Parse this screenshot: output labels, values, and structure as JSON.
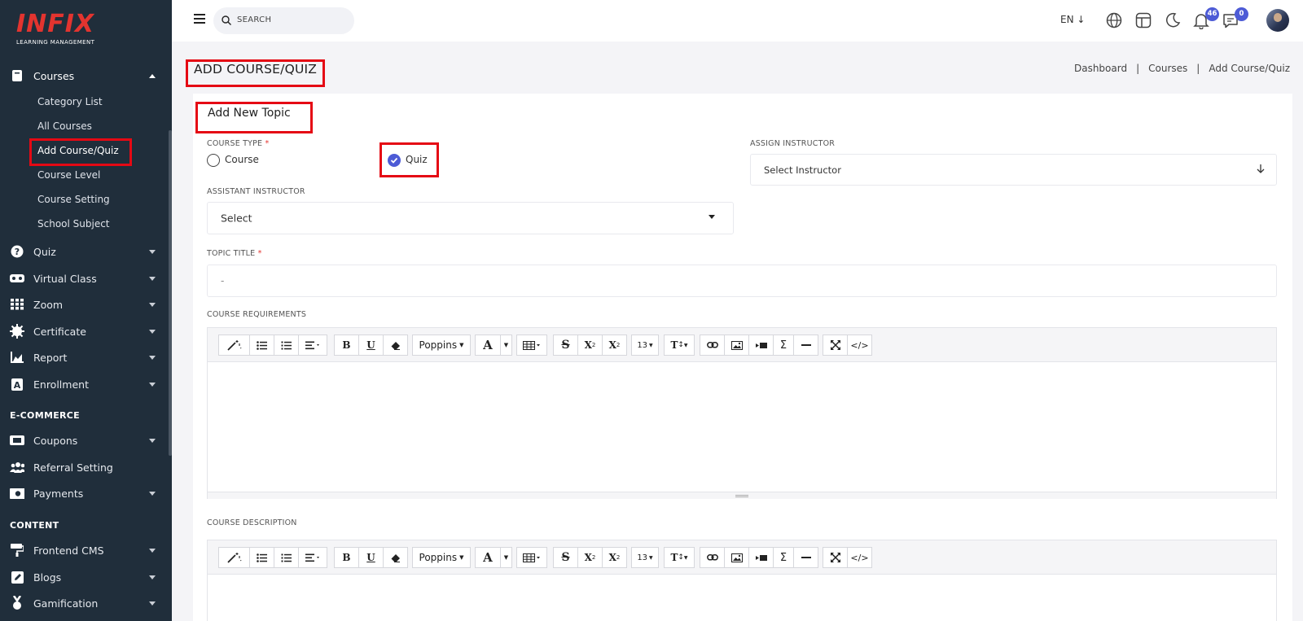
{
  "brand": {
    "logo_text": "INFIX",
    "logo_subtext": "LEARNING MANAGEMENT",
    "accent": "#e3342f",
    "primary": "#4d5bd6"
  },
  "sidebar": {
    "courses": {
      "label": "Courses",
      "icon": "book-icon"
    },
    "course_subitems": [
      "Category List",
      "All Courses",
      "Add Course/Quiz",
      "Course Level",
      "Course Setting",
      "School Subject"
    ],
    "items": [
      {
        "label": "Quiz",
        "icon": "question-circle-icon"
      },
      {
        "label": "Virtual Class",
        "icon": "vr-headset-icon"
      },
      {
        "label": "Zoom",
        "icon": "grid-icon"
      },
      {
        "label": "Certificate",
        "icon": "certificate-icon"
      },
      {
        "label": "Report",
        "icon": "chart-area-icon"
      },
      {
        "label": "Enrollment",
        "icon": "enrollment-icon"
      }
    ],
    "ecommerce_heading": "E-COMMERCE",
    "ecommerce_items": [
      {
        "label": "Coupons",
        "icon": "ticket-icon"
      },
      {
        "label": "Referral Setting",
        "icon": "users-icon"
      },
      {
        "label": "Payments",
        "icon": "money-icon"
      }
    ],
    "content_heading": "CONTENT",
    "content_items": [
      {
        "label": "Frontend CMS",
        "icon": "paint-roller-icon"
      },
      {
        "label": "Blogs",
        "icon": "edit-icon"
      },
      {
        "label": "Gamification",
        "icon": "medal-icon"
      }
    ]
  },
  "topbar": {
    "search_placeholder": "SEARCH",
    "language": "EN",
    "notifications_count": "46",
    "messages_count": "0"
  },
  "page": {
    "title": "ADD COURSE/QUIZ",
    "breadcrumb": [
      "Dashboard",
      "Courses",
      "Add Course/Quiz"
    ]
  },
  "form": {
    "section_title": "Add New Topic",
    "course_type_label": "COURSE TYPE",
    "required_mark": "*",
    "option_course": "Course",
    "option_quiz": "Quiz",
    "assign_instructor_label": "ASSIGN INSTRUCTOR",
    "assign_instructor_value": "Select Instructor",
    "assistant_instructor_label": "ASSISTANT INSTRUCTOR",
    "assistant_instructor_value": "Select",
    "topic_title_label": "TOPIC TITLE",
    "topic_title_value": "-",
    "course_requirements_label": "COURSE REQUIREMENTS",
    "course_description_label": "COURSE DESCRIPTION"
  },
  "editor_toolbar": {
    "font_name": "Poppins",
    "font_size": "13",
    "code_label": "</>",
    "sigma": "Σ"
  }
}
